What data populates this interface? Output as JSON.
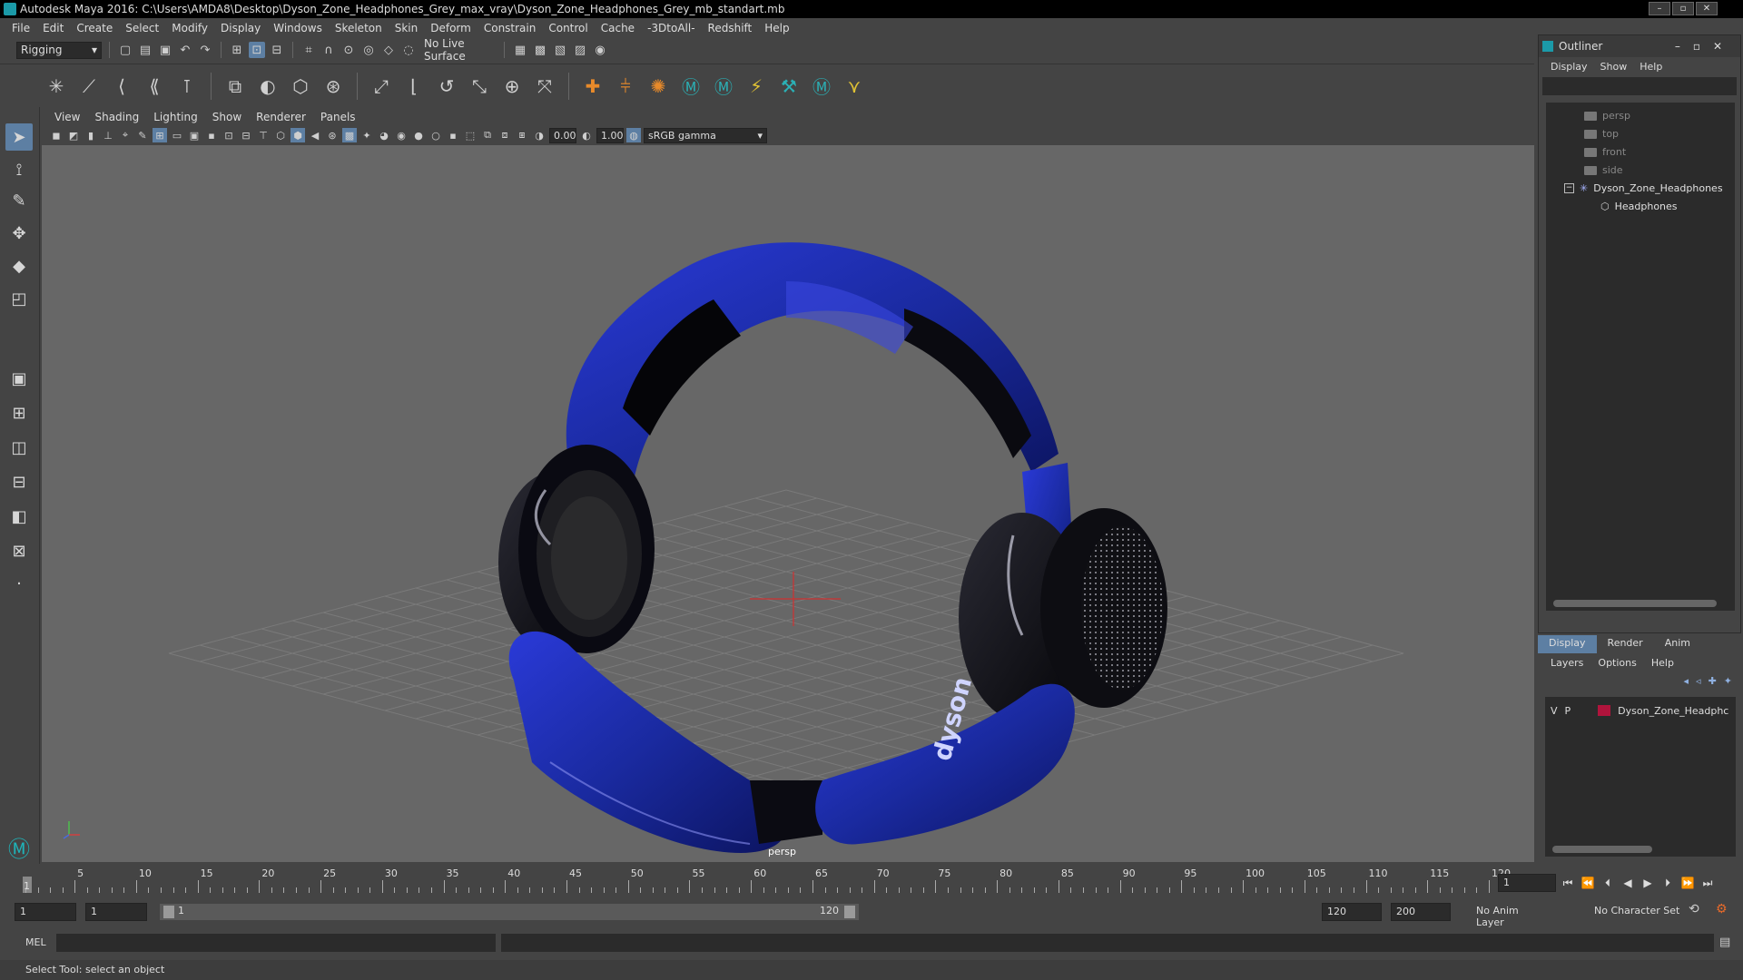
{
  "window": {
    "title": "Autodesk Maya 2016: C:\\Users\\AMDA8\\Desktop\\Dyson_Zone_Headphones_Grey_max_vray\\Dyson_Zone_Headphones_Grey_mb_standart.mb"
  },
  "menubar": [
    "File",
    "Edit",
    "Create",
    "Select",
    "Modify",
    "Display",
    "Windows",
    "Skeleton",
    "Skin",
    "Deform",
    "Constrain",
    "Control",
    "Cache",
    "-3DtoAll-",
    "Redshift",
    "Help"
  ],
  "statusline": {
    "menuset": "Rigging",
    "live_surface": "No Live Surface"
  },
  "panel": {
    "menus": [
      "View",
      "Shading",
      "Lighting",
      "Show",
      "Renderer",
      "Panels"
    ],
    "exposure": "0.00",
    "gamma": "1.00",
    "color_space": "sRGB gamma",
    "camera_label": "persp"
  },
  "model": {
    "brand_text": "dyson",
    "shell_color": "#1a2aa0",
    "pad_color": "#0b0b14"
  },
  "timeline": {
    "ticks": [
      1,
      5,
      10,
      15,
      20,
      25,
      30,
      35,
      40,
      45,
      50,
      55,
      60,
      65,
      70,
      75,
      80,
      85,
      90,
      95,
      100,
      105,
      110,
      115,
      120
    ],
    "start": 1,
    "end": 120,
    "current_frame": "1"
  },
  "range": {
    "start_field": "1",
    "playback_start": "1",
    "slider_start": "1",
    "slider_end": "120",
    "playback_end": "120",
    "end_field": "200",
    "anim_layer": "No Anim Layer",
    "character_set": "No Character Set"
  },
  "cmdline": {
    "lang": "MEL"
  },
  "helpline": "Select Tool: select an object",
  "outliner": {
    "title": "Outliner",
    "menus": [
      "Display",
      "Show",
      "Help"
    ],
    "items": [
      {
        "label": "persp",
        "type": "camera"
      },
      {
        "label": "top",
        "type": "camera"
      },
      {
        "label": "front",
        "type": "camera"
      },
      {
        "label": "side",
        "type": "camera"
      },
      {
        "label": "Dyson_Zone_Headphones",
        "type": "group"
      },
      {
        "label": "Headphones",
        "type": "mesh"
      }
    ]
  },
  "layers": {
    "tabs": [
      "Display",
      "Render",
      "Anim"
    ],
    "menus": [
      "Layers",
      "Options",
      "Help"
    ],
    "row": {
      "v": "V",
      "p": "P",
      "name": "Dyson_Zone_Headphc",
      "color": "#b0143c"
    }
  },
  "colors": {
    "accent": "#5d7fa3",
    "viewport_bg": "#676767",
    "grid": "#7a7a7a",
    "manip_red": "#d03030"
  }
}
